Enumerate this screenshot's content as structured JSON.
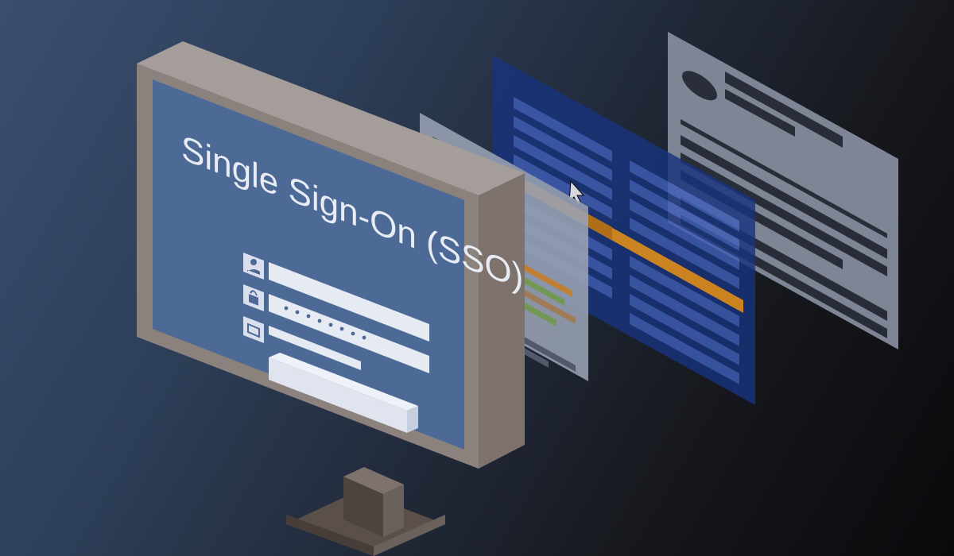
{
  "illustration": {
    "monitor": {
      "title": "Single Sign-On (SSO)",
      "icons": [
        "user-icon",
        "lock-icon",
        "checkbox-icon"
      ],
      "fields": [
        "username-field",
        "password-field",
        "remember-me-checkbox"
      ],
      "button": "login-button"
    },
    "panels": [
      "panel-document-small",
      "panel-app-blue",
      "panel-article-grey"
    ],
    "cursor": "pointer-cursor",
    "colors": {
      "monitor_screen": "#4d6a96",
      "monitor_frame_light": "#9b9390",
      "monitor_frame_mid": "#7e726d",
      "monitor_frame_dark": "#5a4f4a",
      "field": "#e6eaf2",
      "panel_grey": "#878f9f",
      "panel_blue": "#1f3a7a",
      "accent_orange": "#f29a1f",
      "text_light": "#e8ecf4"
    }
  }
}
